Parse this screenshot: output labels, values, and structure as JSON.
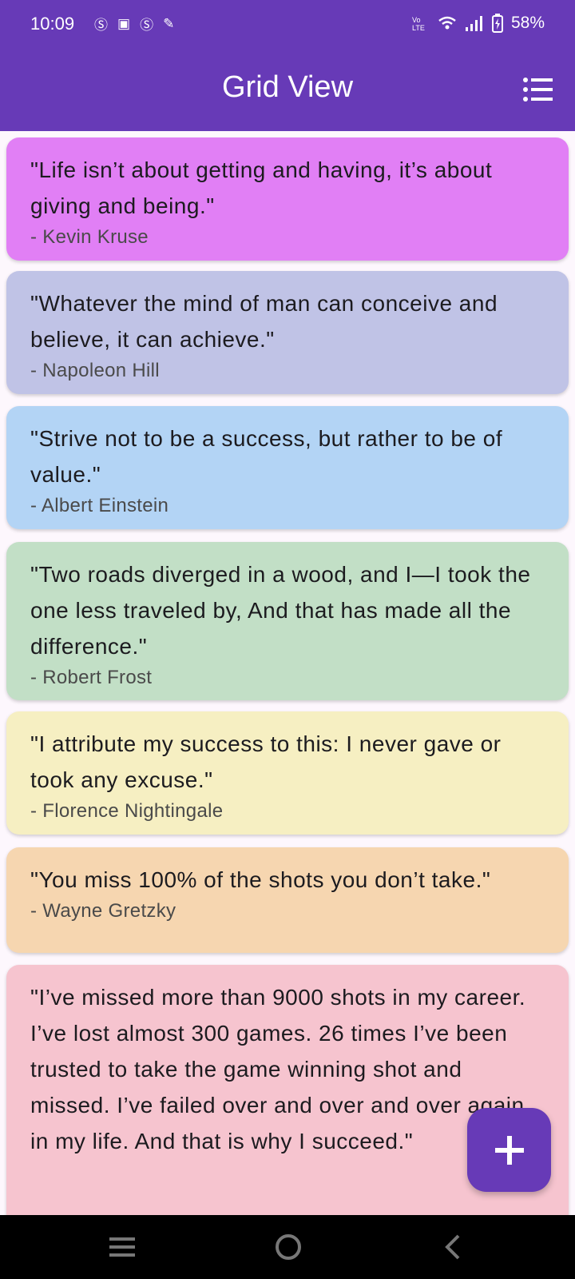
{
  "status_bar": {
    "time": "10:09",
    "battery": "58%",
    "left_icons": [
      "s-icon",
      "gallery-icon",
      "s-icon",
      "edit-icon"
    ],
    "right_icons": [
      "volte-icon",
      "wifi-icon",
      "signal-icon",
      "battery-icon"
    ]
  },
  "app_bar": {
    "title": "Grid View",
    "background": "#673ab7",
    "action_icon": "list-view-icon"
  },
  "quotes": [
    {
      "text": "\"Life isn’t about getting and having, it’s about giving and being.\"",
      "author": "- Kevin Kruse",
      "color": "#e17ff5"
    },
    {
      "text": "\"Whatever the mind of man can conceive and believe, it can achieve.\"",
      "author": "- Napoleon Hill",
      "color": "#c0c3e6"
    },
    {
      "text": "\"Strive not to be a success, but rather to be of value.\"",
      "author": "- Albert Einstein",
      "color": "#b3d4f5"
    },
    {
      "text": "\"Two roads diverged in a wood, and I—I took the one less traveled by, And that has made all the difference.\"",
      "author": "- Robert Frost",
      "color": "#c2dfc6"
    },
    {
      "text": "\"I attribute my success to this: I never gave or took any excuse.\"",
      "author": "- Florence Nightingale",
      "color": "#f6efc2"
    },
    {
      "text": "\"You miss 100% of the shots you don’t take.\"",
      "author": "- Wayne Gretzky",
      "color": "#f6d6b0"
    },
    {
      "text": "\"I’ve missed more than 9000 shots in my career. I’ve lost almost 300 games. 26 times I’ve been trusted to take the game winning shot and missed. I’ve failed over and over and over again in my life. And that is why I succeed.\"",
      "author": "",
      "color": "#f6c4cf"
    }
  ],
  "fab": {
    "icon": "plus-icon"
  },
  "nav_bar": {
    "icons": [
      "menu-icon",
      "home-icon",
      "back-icon"
    ]
  }
}
